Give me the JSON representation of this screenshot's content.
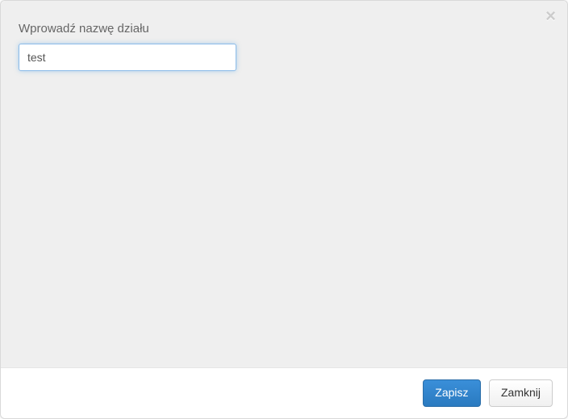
{
  "modal": {
    "field_label": "Wprowadź nazwę działu",
    "input_value": "test",
    "save_label": "Zapisz",
    "close_label": "Zamknij",
    "close_icon": "×"
  }
}
